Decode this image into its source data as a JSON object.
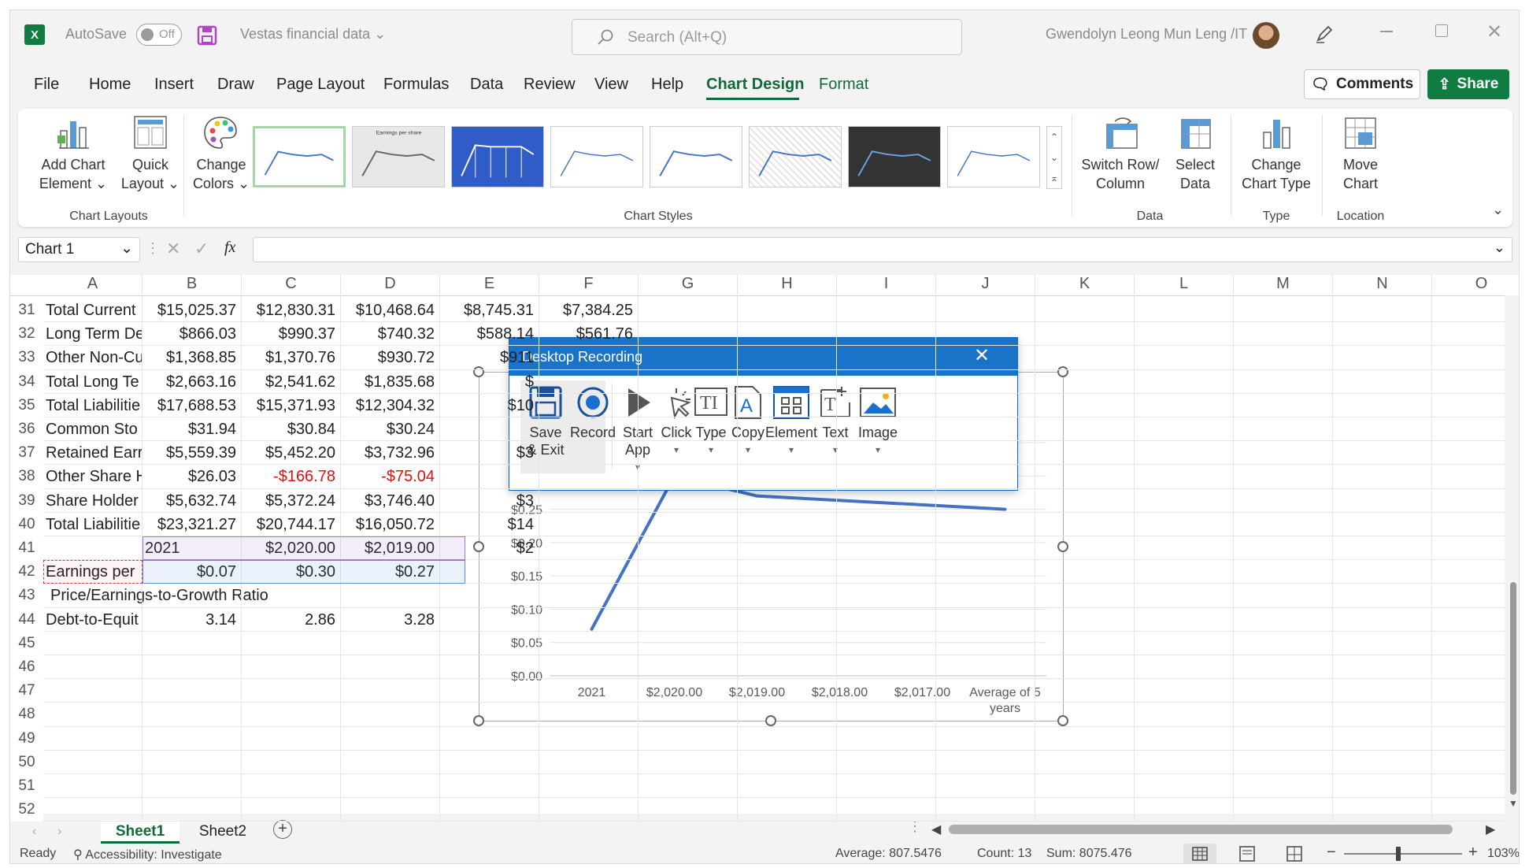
{
  "titlebar": {
    "app_icon": "X",
    "autosave_label": "AutoSave",
    "autosave_state": "Off",
    "doc_title": "Vestas financial data",
    "search_placeholder": "Search (Alt+Q)",
    "user_name": "Gwendolyn Leong Mun Leng /IT"
  },
  "menu": {
    "items": [
      "File",
      "Home",
      "Insert",
      "Draw",
      "Page Layout",
      "Formulas",
      "Data",
      "Review",
      "View",
      "Help",
      "Chart Design",
      "Format"
    ],
    "active": "Chart Design",
    "comments_label": "Comments",
    "share_label": "Share"
  },
  "ribbon": {
    "add_chart_element": [
      "Add Chart",
      "Element"
    ],
    "quick_layout": [
      "Quick",
      "Layout"
    ],
    "change_colors": [
      "Change",
      "Colors"
    ],
    "group_chart_layouts": "Chart Layouts",
    "group_chart_styles": "Chart Styles",
    "switch_row_col": [
      "Switch Row/",
      "Column"
    ],
    "select_data": [
      "Select",
      "Data"
    ],
    "group_data": "Data",
    "change_chart_type": [
      "Change",
      "Chart Type"
    ],
    "group_type": "Type",
    "move_chart": [
      "Move",
      "Chart"
    ],
    "group_location": "Location"
  },
  "formula_bar": {
    "name_box": "Chart 1",
    "fx": "fx",
    "content": ""
  },
  "columns": [
    "A",
    "B",
    "C",
    "D",
    "E",
    "F",
    "G",
    "H",
    "I",
    "J",
    "K",
    "L",
    "M",
    "N",
    "O"
  ],
  "rows": [
    {
      "n": "31",
      "a": "Total Current",
      "b": "$15,025.37",
      "c": "$12,830.31",
      "d": "$10,468.64",
      "e": "$8,745.31",
      "f": "$7,384.25"
    },
    {
      "n": "32",
      "a": "Long Term De",
      "b": "$866.03",
      "c": "$990.37",
      "d": "$740.32",
      "e": "$588.14",
      "f": "$561.76"
    },
    {
      "n": "33",
      "a": "Other Non-Cu",
      "b": "$1,368.85",
      "c": "$1,370.76",
      "d": "$930.72",
      "e": "$911",
      "f": ""
    },
    {
      "n": "34",
      "a": "Total Long Te",
      "b": "$2,663.16",
      "c": "$2,541.62",
      "d": "$1,835.68",
      "e": "$",
      "f": ""
    },
    {
      "n": "35",
      "a": "Total Liabilitie",
      "b": "$17,688.53",
      "c": "$15,371.93",
      "d": "$12,304.32",
      "e": "$10",
      "f": ""
    },
    {
      "n": "36",
      "a": "Common Sto",
      "b": "$31.94",
      "c": "$30.84",
      "d": "$30.24",
      "e": "",
      "f": ""
    },
    {
      "n": "37",
      "a": "Retained Earr",
      "b": "$5,559.39",
      "c": "$5,452.20",
      "d": "$3,732.96",
      "e": "$3",
      "f": ""
    },
    {
      "n": "38",
      "a": "Other Share H",
      "b": "$26.03",
      "c": "-$166.78",
      "d": "-$75.04",
      "e": "",
      "f": ""
    },
    {
      "n": "39",
      "a": "Share Holder",
      "b": "$5,632.74",
      "c": "$5,372.24",
      "d": "$3,746.40",
      "e": "$3",
      "f": ""
    },
    {
      "n": "40",
      "a": "Total Liabilitie",
      "b": "$23,321.27",
      "c": "$20,744.17",
      "d": "$16,050.72",
      "e": "$14",
      "f": ""
    },
    {
      "n": "41",
      "a": "",
      "b": "2021",
      "c": "$2,020.00",
      "d": "$2,019.00",
      "e": "$2",
      "f": ""
    },
    {
      "n": "42",
      "a": "Earnings per",
      "b": "$0.07",
      "c": "$0.30",
      "d": "$0.27",
      "e": "",
      "f": ""
    },
    {
      "n": "43",
      "a": "Price/Earnings-to-Growth Ratio",
      "b": "",
      "c": "",
      "d": "",
      "e": "",
      "f": ""
    },
    {
      "n": "44",
      "a": "Debt-to-Equit",
      "b": "3.14",
      "c": "2.86",
      "d": "3.28",
      "e": "",
      "f": ""
    },
    {
      "n": "45"
    },
    {
      "n": "46"
    },
    {
      "n": "47"
    },
    {
      "n": "48"
    },
    {
      "n": "49"
    },
    {
      "n": "50"
    },
    {
      "n": "51"
    },
    {
      "n": "52"
    }
  ],
  "chart_data": {
    "type": "line",
    "categories": [
      "2021",
      "$2,020.00",
      "$2,019.00",
      "$2,018.00",
      "$2,017.00",
      "Average of 5 years"
    ],
    "y_ticks": [
      "$0.00",
      "$0.05",
      "$0.10",
      "$0.15",
      "$0.20",
      "$0.25",
      "$0.3",
      "$0.3"
    ],
    "ylim": [
      0,
      0.35
    ],
    "series": [
      {
        "values": [
          0.07,
          0.3,
          0.27,
          null,
          null,
          0.25
        ],
        "color": "#4472c4"
      }
    ]
  },
  "recorder": {
    "title": "Desktop Recording",
    "tools": [
      {
        "id": "save",
        "label": [
          "Save",
          "& Exit"
        ]
      },
      {
        "id": "record",
        "label": [
          "Record"
        ]
      },
      {
        "id": "start",
        "label": [
          "Start",
          "App"
        ]
      },
      {
        "id": "click",
        "label": [
          "Click"
        ]
      },
      {
        "id": "type",
        "label": [
          "Type"
        ]
      },
      {
        "id": "copy",
        "label": [
          "Copy"
        ]
      },
      {
        "id": "element",
        "label": [
          "Element"
        ]
      },
      {
        "id": "text",
        "label": [
          "Text"
        ]
      },
      {
        "id": "image",
        "label": [
          "Image"
        ]
      }
    ]
  },
  "sheets": {
    "tabs": [
      "Sheet1",
      "Sheet2"
    ],
    "active": "Sheet1"
  },
  "status": {
    "ready": "Ready",
    "accessibility": "Accessibility: Investigate",
    "average": "Average: 807.5476",
    "count": "Count: 13",
    "sum": "Sum: 8075.476",
    "zoom": "103%"
  },
  "colors": {
    "accent": "#107c41",
    "chart_line": "#4472c4",
    "recorder_title": "#1a73c9",
    "negative": "#e01010"
  }
}
